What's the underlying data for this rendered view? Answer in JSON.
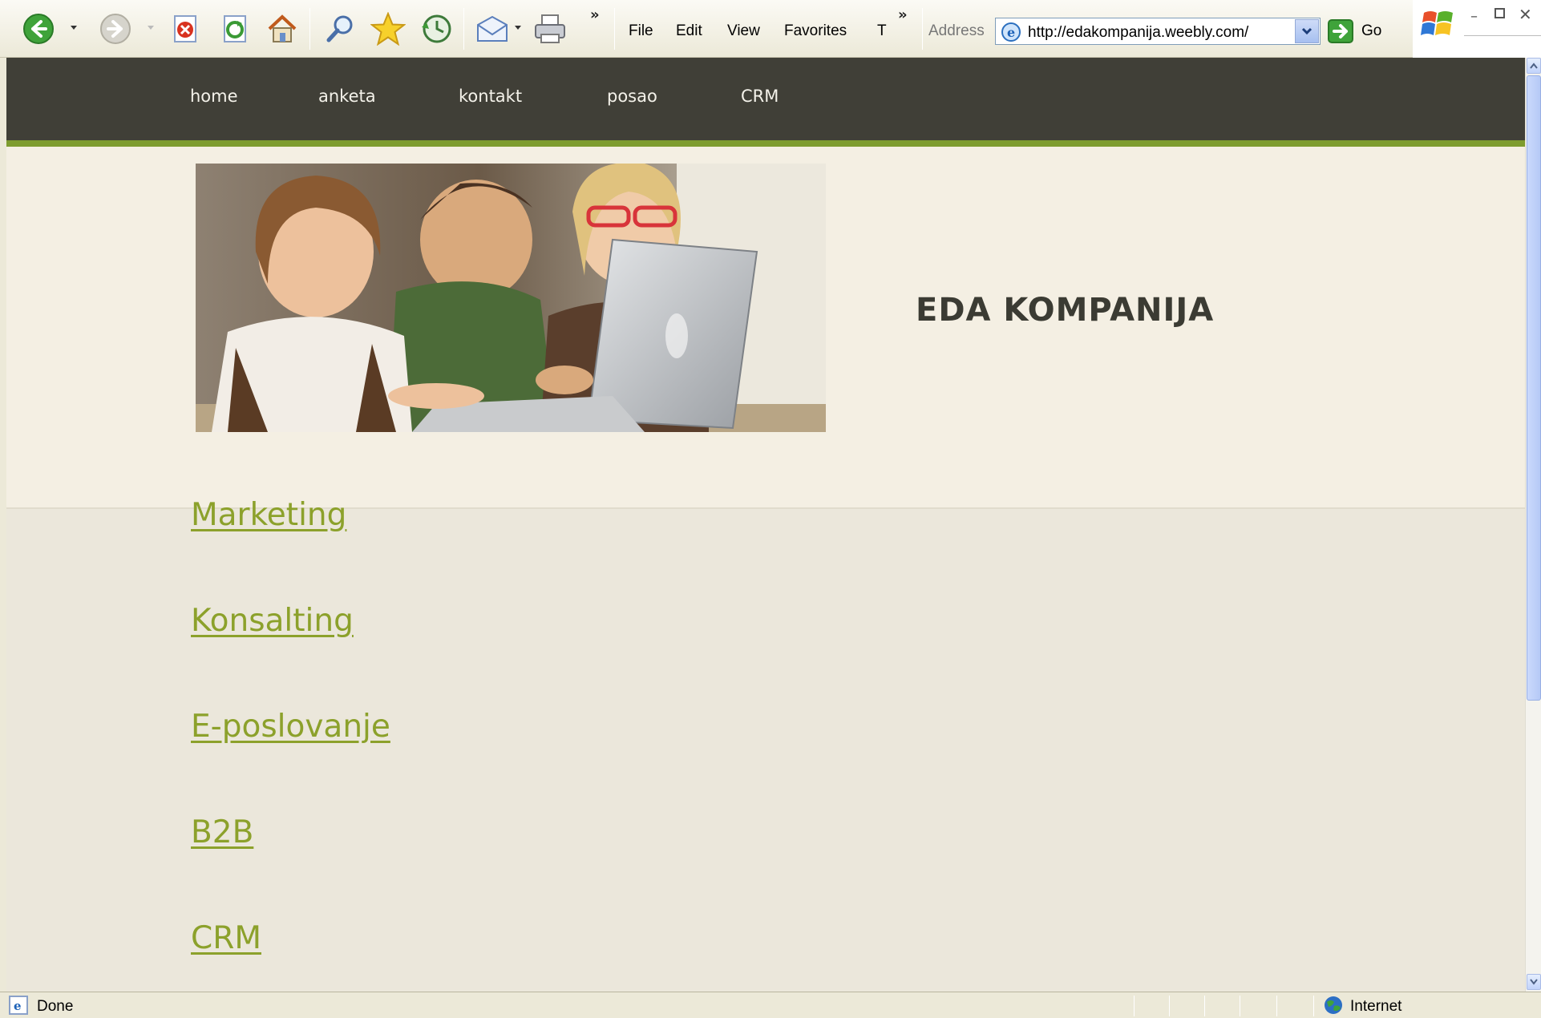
{
  "browser": {
    "menu": {
      "file": "File",
      "edit": "Edit",
      "view": "View",
      "favorites": "Favorites",
      "tools": "T"
    },
    "overflow_chevron": "»",
    "address_label": "Address",
    "address_value": "http://edakompanija.weebly.com/",
    "go_label": "Go",
    "status_text": "Done",
    "zone_text": "Internet",
    "icons": [
      "back-icon",
      "forward-icon",
      "stop-icon",
      "refresh-icon",
      "home-icon",
      "search-icon",
      "favorites-star-icon",
      "history-icon",
      "mail-icon",
      "print-icon",
      "windows-logo-icon",
      "minimize-icon",
      "restore-icon",
      "close-icon"
    ]
  },
  "site": {
    "nav": {
      "home": "home",
      "anketa": "anketa",
      "kontakt": "kontakt",
      "posao": "posao",
      "crm": "CRM"
    },
    "title": "EDA KOMPANIJA",
    "links": {
      "marketing": "Marketing",
      "konsalting": "Konsalting",
      "eposlovanje": "E-poslovanje",
      "b2b": "B2B",
      "crm": "CRM"
    },
    "colors": {
      "nav_bg": "#403f37",
      "accent_green": "#7e9c2f",
      "link_green": "#8ca12b",
      "header_bg": "#f4efe3",
      "page_bg": "#ebe7db"
    }
  }
}
